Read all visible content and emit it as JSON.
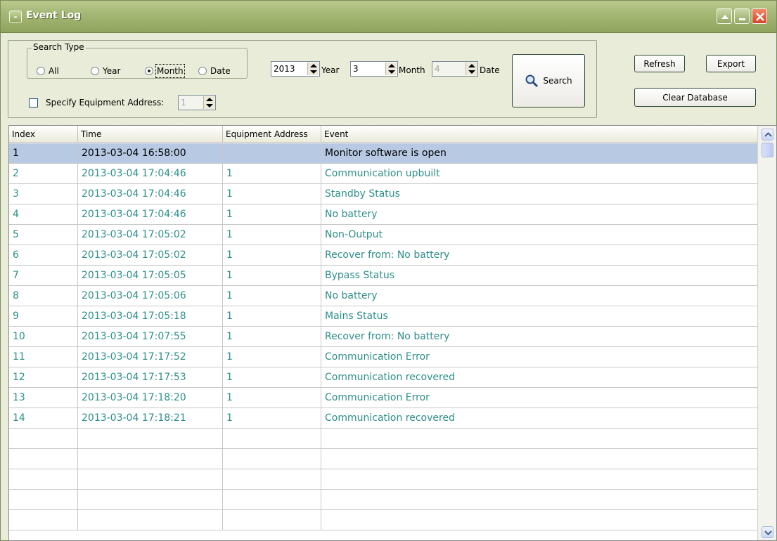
{
  "window": {
    "title": "Event Log"
  },
  "search_type": {
    "legend": "Search Type",
    "options": [
      "All",
      "Year",
      "Month",
      "Date"
    ],
    "selected": "Month"
  },
  "date_filter": {
    "year_value": "2013",
    "year_label": "Year",
    "month_value": "3",
    "month_label": "Month",
    "date_value": "4",
    "date_label": "Date"
  },
  "equipment_filter": {
    "label": "Specify Equipment Address:",
    "value": "1",
    "checked": false
  },
  "buttons": {
    "search": "Search",
    "refresh": "Refresh",
    "export": "Export",
    "clear_database": "Clear Database"
  },
  "table": {
    "columns": [
      "Index",
      "Time",
      "Equipment Address",
      "Event"
    ],
    "rows": [
      {
        "index": "1",
        "time": "2013-03-04 16:58:00",
        "address": "",
        "event": "Monitor software is open"
      },
      {
        "index": "2",
        "time": "2013-03-04 17:04:46",
        "address": "1",
        "event": "Communication upbuilt"
      },
      {
        "index": "3",
        "time": "2013-03-04 17:04:46",
        "address": "1",
        "event": "Standby Status"
      },
      {
        "index": "4",
        "time": "2013-03-04 17:04:46",
        "address": "1",
        "event": "No battery"
      },
      {
        "index": "5",
        "time": "2013-03-04 17:05:02",
        "address": "1",
        "event": "Non-Output"
      },
      {
        "index": "6",
        "time": "2013-03-04 17:05:02",
        "address": "1",
        "event": "Recover from: No battery"
      },
      {
        "index": "7",
        "time": "2013-03-04 17:05:05",
        "address": "1",
        "event": "Bypass Status"
      },
      {
        "index": "8",
        "time": "2013-03-04 17:05:06",
        "address": "1",
        "event": "No battery"
      },
      {
        "index": "9",
        "time": "2013-03-04 17:05:18",
        "address": "1",
        "event": "Mains Status"
      },
      {
        "index": "10",
        "time": "2013-03-04 17:07:55",
        "address": "1",
        "event": "Recover from: No battery"
      },
      {
        "index": "11",
        "time": "2013-03-04 17:17:52",
        "address": "1",
        "event": "Communication Error"
      },
      {
        "index": "12",
        "time": "2013-03-04 17:17:53",
        "address": "1",
        "event": "Communication recovered"
      },
      {
        "index": "13",
        "time": "2013-03-04 17:18:20",
        "address": "1",
        "event": "Communication Error"
      },
      {
        "index": "14",
        "time": "2013-03-04 17:18:21",
        "address": "1",
        "event": "Communication recovered"
      }
    ],
    "selected_row": 0,
    "empty_rows": 5
  },
  "colors": {
    "row_text": "#2e8f8a",
    "selected_row_bg": "#b8c9e4",
    "titlebar": "#a3b673"
  }
}
